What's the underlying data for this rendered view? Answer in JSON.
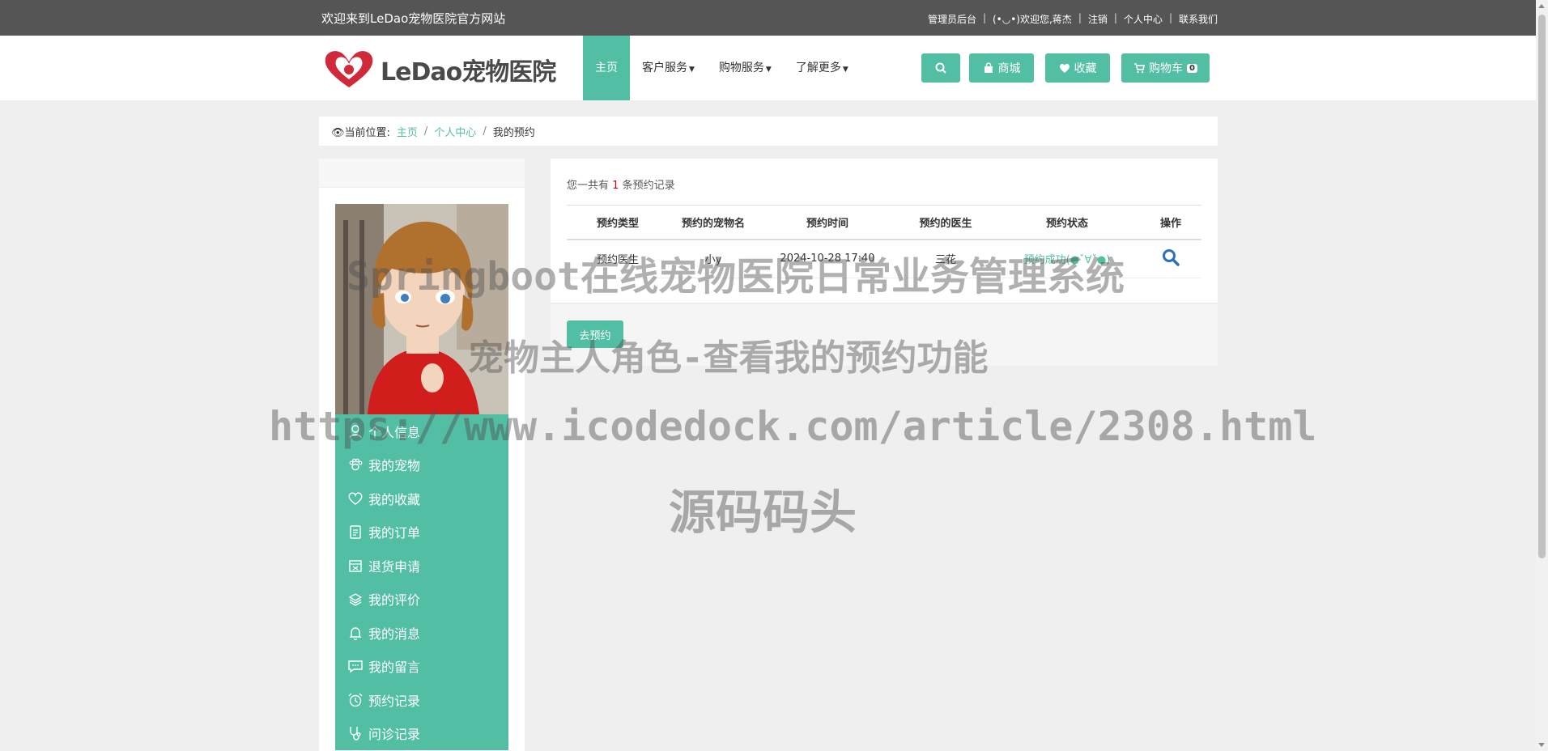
{
  "topbar": {
    "welcome": "欢迎来到LeDao宠物医院官方网站",
    "links": [
      "管理员后台",
      "(•◡•)欢迎您,蒋杰",
      "注销",
      "个人中心",
      "联系我们"
    ]
  },
  "header": {
    "logo_text": "LeDao宠物医院",
    "nav": [
      {
        "label": "主页",
        "dropdown": false
      },
      {
        "label": "客户服务",
        "dropdown": true
      },
      {
        "label": "购物服务",
        "dropdown": true
      },
      {
        "label": "了解更多",
        "dropdown": true
      }
    ],
    "buttons": {
      "mall": "商城",
      "favorites": "收藏",
      "cart": "购物车",
      "cart_count": "0"
    }
  },
  "breadcrumb": {
    "prefix": "👁当前位置:",
    "home": "主页",
    "center": "个人中心",
    "current": "我的预约",
    "sep": "/"
  },
  "sidebar": {
    "menu": [
      {
        "label": "个人信息",
        "icon": "user-icon"
      },
      {
        "label": "我的宠物",
        "icon": "paw-icon"
      },
      {
        "label": "我的收藏",
        "icon": "heart-icon"
      },
      {
        "label": "我的订单",
        "icon": "clipboard-icon"
      },
      {
        "label": "退货申请",
        "icon": "return-box-icon"
      },
      {
        "label": "我的评价",
        "icon": "review-icon"
      },
      {
        "label": "我的消息",
        "icon": "bell-icon"
      },
      {
        "label": "我的留言",
        "icon": "comment-icon"
      },
      {
        "label": "预约记录",
        "icon": "alarm-clock-icon"
      },
      {
        "label": "问诊记录",
        "icon": "stethoscope-icon"
      }
    ]
  },
  "main": {
    "summary_prefix": "您一共有",
    "summary_count": "1",
    "summary_suffix": "条预约记录",
    "columns": [
      "预约类型",
      "预约的宠物名",
      "预约时间",
      "预约的医生",
      "预约状态",
      "操作"
    ],
    "rows": [
      {
        "type": "预约医生",
        "pet": "小y",
        "time": "2024-10-28 17:40",
        "doctor": "三花",
        "status": "预约成功(●ˇ∀ˇ●)"
      }
    ],
    "go_button": "去预约"
  },
  "watermark": {
    "line1": "Springboot在线宠物医院日常业务管理系统",
    "line2": "宠物主人角色-查看我的预约功能",
    "line3": "https://www.icodedock.com/article/2308.html",
    "line4": "源码码头"
  },
  "colors": {
    "accent": "#52bfa5",
    "topbar": "#555555",
    "count": "#d0021b"
  }
}
